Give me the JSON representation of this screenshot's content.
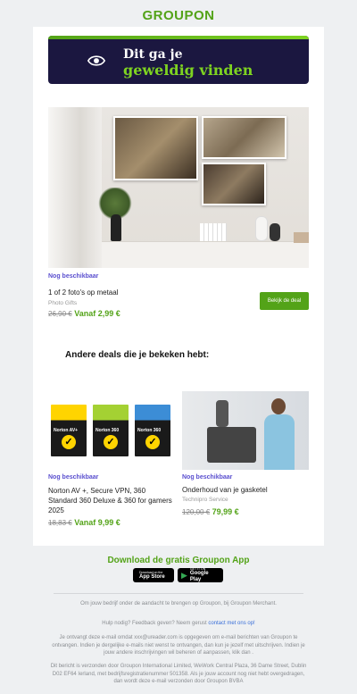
{
  "brand": {
    "logo": "GROUPON"
  },
  "hero": {
    "line1": "Dit ga je",
    "line2": "geweldig vinden",
    "icon": "eye-icon"
  },
  "main_deal": {
    "status": "Nog beschikbaar",
    "title": "1 of 2 foto's op metaal",
    "merchant": "Photo Gifts",
    "old_price": "26,90 €",
    "new_price": "Vanaf 2,99 €",
    "button": "Bekijk de deal"
  },
  "section_title": "Andere deals die je bekeken hebt:",
  "deals": [
    {
      "status": "Nog beschikbaar",
      "title": "Norton AV +, Secure VPN, 360 Standard 360 Deluxe & 360 for gamers 2025",
      "merchant": "",
      "old_price": "18,83 €",
      "new_price": "Vanaf 9,99 €",
      "box_labels": [
        "Norton AV+",
        "Norton 360",
        "Norton 360"
      ]
    },
    {
      "status": "Nog beschikbaar",
      "title": "Onderhoud van je gasketel",
      "merchant": "Technipro Service",
      "old_price": "120,00 €",
      "new_price": "79,99 €"
    }
  ],
  "app": {
    "title": "Download de gratis Groupon App",
    "appstore_small": "Download on the",
    "appstore_big": "App Store",
    "play_small": "GET IT ON",
    "play_big": "Google Play"
  },
  "footer": {
    "thanks": "Om jouw bedrijf onder de aandacht te brengen op Groupon, bij Groupon Merchant.",
    "help_prefix": "Hulp nodig? Feedback geven? Neem gerust ",
    "help_link": "contact met ons op!",
    "optin": "Je ontvangt deze e-mail omdat xxx@ureader.com is opgegeven om e-mail berichten van Groupon te ontvangen. Indien je dergelijke e-mails niet wenst te ontvangen, dan kun je jezelf met uitschrijven. Indien je jouw andere inschrijvingen wil beheren of aanpassen, klik dan .",
    "sender": "Dit bericht is verzonden door Groupon International Limited, WeWork Central Plaza, 36 Dame Street, Dublin D02 EF64 Ierland, met bedrijfsregistratienummer 501358. Als je jouw account nog niet hebt overgedragen, dan wordt deze e-mail verzonden door Groupon BVBA"
  },
  "colors": {
    "brand_green": "#53a318",
    "status_purple": "#5a4fcf",
    "hero_bg": "#1b1740"
  }
}
